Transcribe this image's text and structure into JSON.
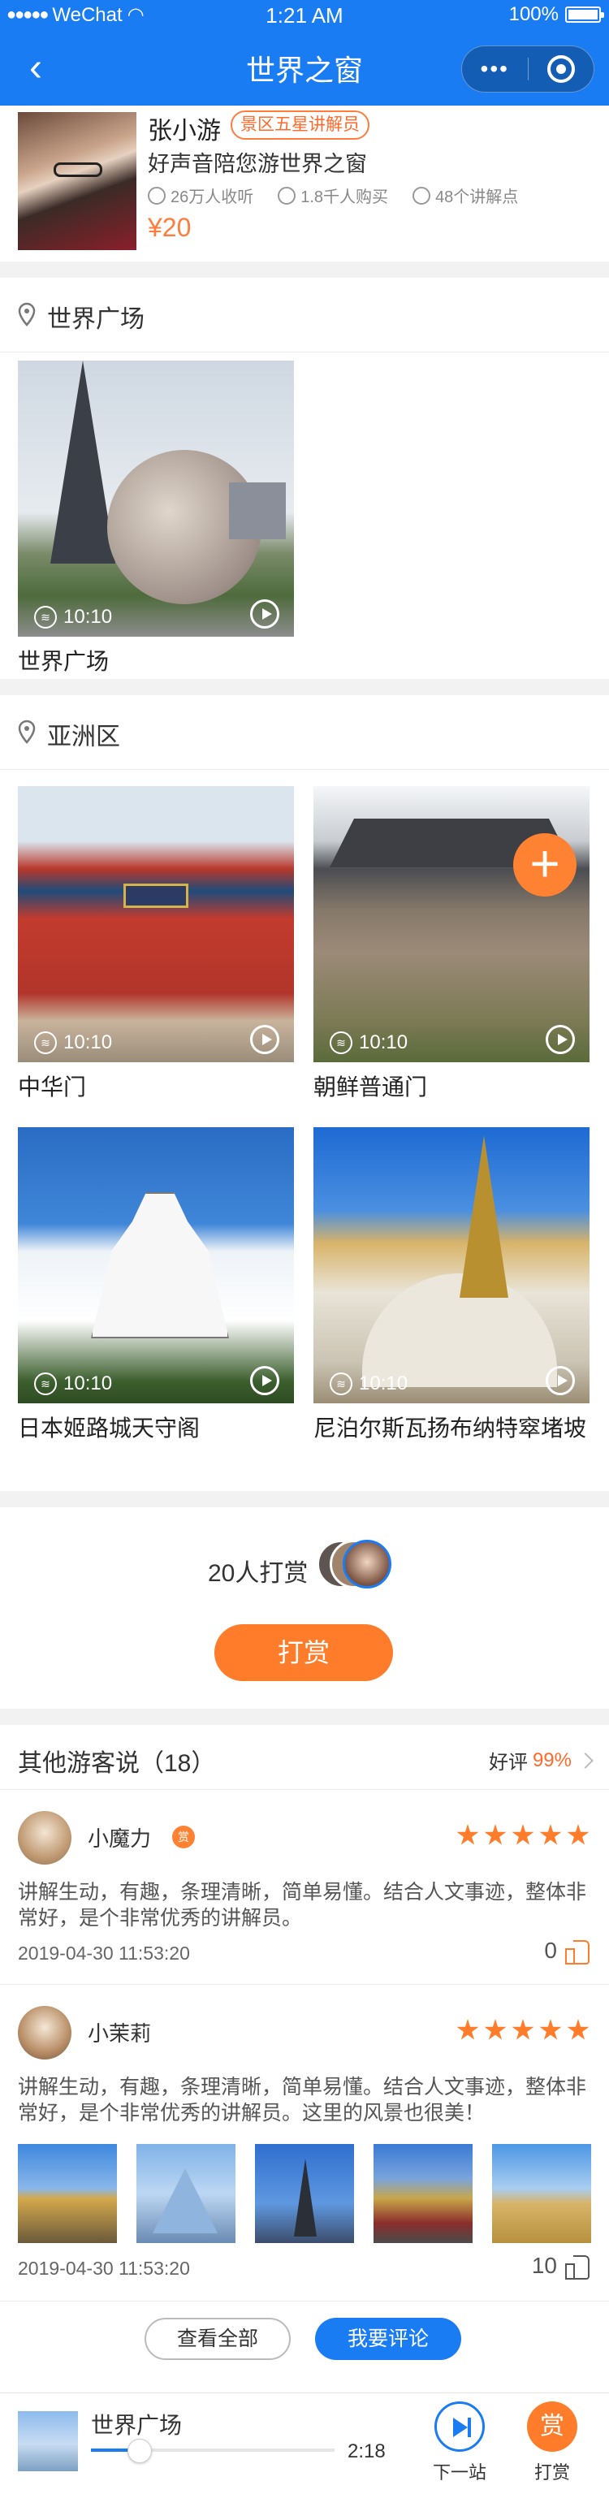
{
  "status_bar": {
    "carrier": "WeChat",
    "time": "1:21 AM",
    "battery": "100%"
  },
  "nav": {
    "title": "世界之窗",
    "more_icon": "more-dots-icon",
    "close_icon": "target-circle-icon"
  },
  "guide": {
    "name": "张小游",
    "badge": "景区五星讲解员",
    "desc": "好声音陪您游世界之窗",
    "listens": "26万人收听",
    "buyers": "1.8千人购买",
    "points": "48个讲解点",
    "price": "¥20"
  },
  "sections": [
    {
      "title": "世界广场",
      "items": [
        {
          "name": "世界广场",
          "duration": "10:10"
        }
      ]
    },
    {
      "title": "亚洲区",
      "items": [
        {
          "name": "中华门",
          "duration": "10:10"
        },
        {
          "name": "朝鲜普通门",
          "duration": "10:10"
        },
        {
          "name": "日本姬路城天守阁",
          "duration": "10:10"
        },
        {
          "name": "尼泊尔斯瓦扬布纳特窣堵坡",
          "duration": "10:10"
        }
      ]
    }
  ],
  "tip": {
    "count_text": "20人打赏",
    "button": "打赏"
  },
  "comments": {
    "title": "其他游客说（18）",
    "rating_label": "好评",
    "rating_value": "99%",
    "items": [
      {
        "user": "小魔力",
        "vip": "赏",
        "stars": 5,
        "text": "讲解生动，有趣，条理清晰，简单易懂。结合人文事迹，整体非常好，是个非常优秀的讲解员。",
        "time": "2019-04-30  11:53:20",
        "likes": "0"
      },
      {
        "user": "小茉莉",
        "stars": 5,
        "text": "讲解生动，有趣，条理清晰，简单易懂。结合人文事迹，整体非常好，是个非常优秀的讲解员。这里的风景也很美！",
        "time": "2019-04-30  11:53:20",
        "likes": "10"
      }
    ],
    "view_all": "查看全部",
    "write": "我要评论"
  },
  "player": {
    "title": "世界广场",
    "time": "2:18",
    "progress": 0.2,
    "next": "下一站",
    "tip": "打赏",
    "tip_icon_text": "赏"
  },
  "colors": {
    "primary": "#1a7cf2",
    "accent": "#ff7d2a"
  }
}
